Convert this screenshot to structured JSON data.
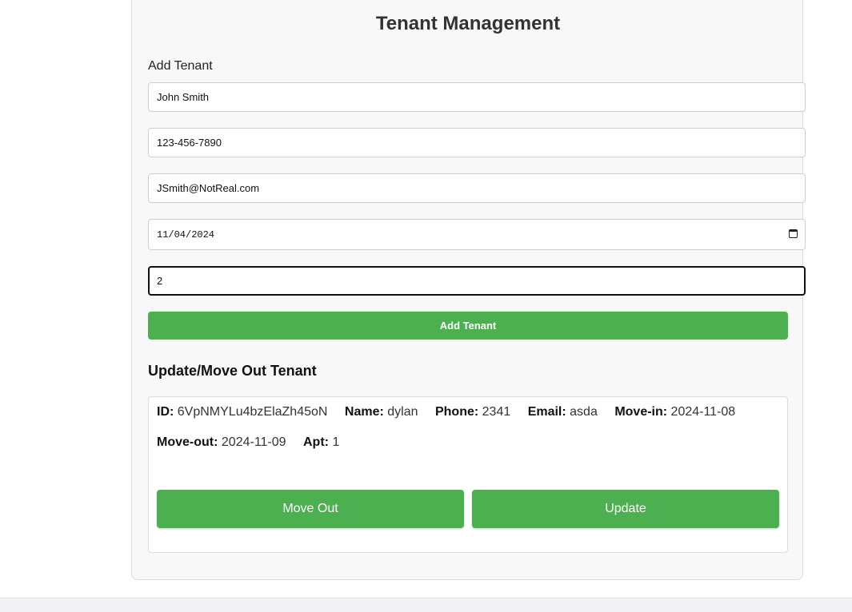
{
  "page": {
    "title": "Tenant Management"
  },
  "add_form": {
    "section_label": "Add Tenant",
    "name_value": "John Smith",
    "phone_value": "123-456-7890",
    "email_value": "JSmith@NotReal.com",
    "date_value": "11/04/2024",
    "apt_value": "2",
    "submit_label": "Add Tenant"
  },
  "update_section": {
    "title": "Update/Move Out Tenant",
    "tenant": {
      "id_label": "ID:",
      "id": "6VpNMYLu4bzElaZh45oN",
      "name_label": "Name:",
      "name": "dylan",
      "phone_label": "Phone:",
      "phone": "2341",
      "email_label": "Email:",
      "email": "asda",
      "movein_label": "Move-in:",
      "movein": "2024-11-08",
      "moveout_label": "Move-out:",
      "moveout": "2024-11-09",
      "apt_label": "Apt:",
      "apt": "1"
    },
    "move_out_label": "Move Out",
    "update_label": "Update"
  },
  "colors": {
    "accent": "#4caf50",
    "panel": "#f8f8f8"
  }
}
